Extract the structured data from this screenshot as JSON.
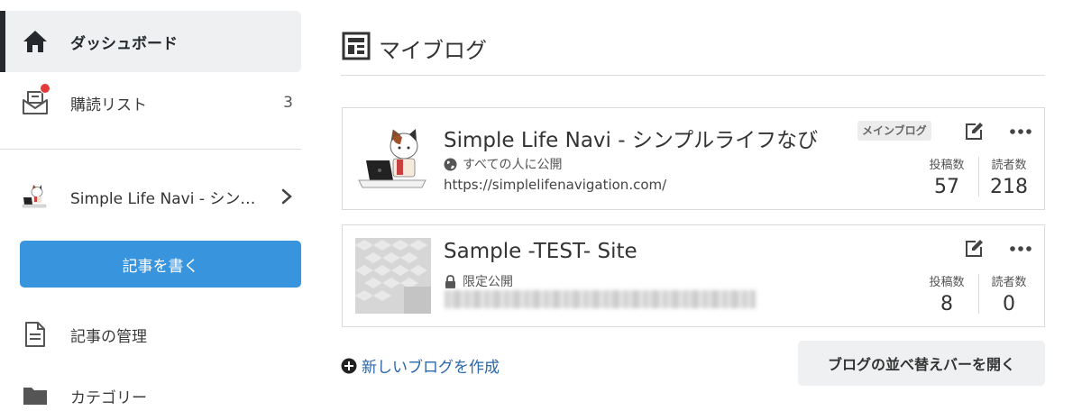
{
  "sidebar": {
    "dashboard_label": "ダッシュボード",
    "reading_list_label": "購読リスト",
    "reading_list_count": "3",
    "blog_switch_label": "Simple Life Navi - シン…",
    "write_button_label": "記事を書く",
    "manage_label": "記事の管理",
    "category_label": "カテゴリー"
  },
  "main": {
    "title": "マイブログ",
    "blogs": [
      {
        "name": "Simple Life Navi - シンプルライフなび",
        "visibility": "すべての人に公開",
        "url": "https://simplelifenavigation.com/",
        "main_tag": "メインブログ",
        "posts_label": "投稿数",
        "posts": "57",
        "readers_label": "読者数",
        "readers": "218"
      },
      {
        "name": "Sample -TEST- Site",
        "visibility": "限定公開",
        "posts_label": "投稿数",
        "posts": "8",
        "readers_label": "読者数",
        "readers": "0"
      }
    ],
    "new_blog_label": "新しいブログを作成",
    "sort_button_label": "ブログの並べ替えバーを開く"
  },
  "colors": {
    "accent_blue": "#3894dc",
    "link_blue": "#2a66a8",
    "badge_red": "#e33b3b",
    "active_bar": "#25292e"
  },
  "icons": [
    "home-icon",
    "reading-list-icon",
    "chevron-right-icon",
    "document-icon",
    "folder-icon",
    "my-blog-icon",
    "globe-icon",
    "lock-icon",
    "edit-icon",
    "more-icon",
    "plus-circle-icon"
  ]
}
